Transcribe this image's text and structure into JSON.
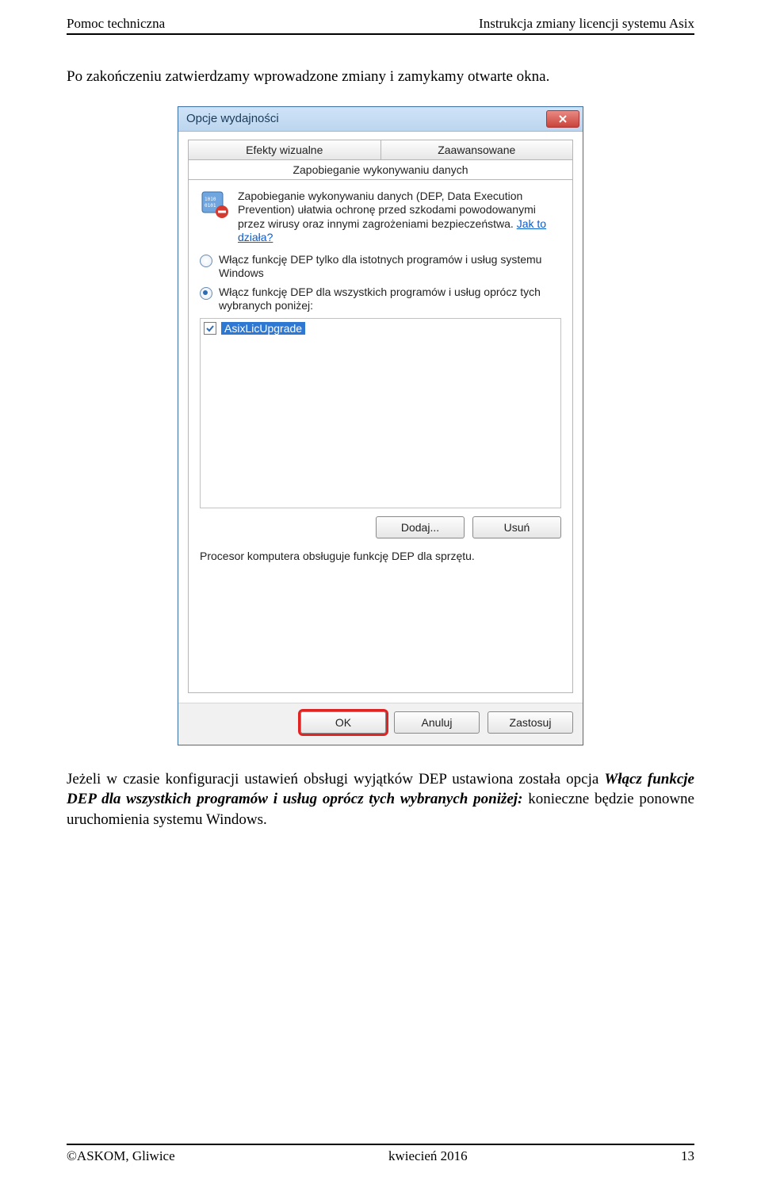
{
  "header": {
    "left": "Pomoc techniczna",
    "right": "Instrukcja zmiany licencji systemu Asix"
  },
  "intro": "Po zakończeniu zatwierdzamy wprowadzone zmiany i zamykamy otwarte okna.",
  "dialog": {
    "title": "Opcje wydajności",
    "tabs": {
      "visual": "Efekty wizualne",
      "advanced": "Zaawansowane",
      "dep": "Zapobieganie wykonywaniu danych"
    },
    "dep_description": "Zapobieganie wykonywaniu danych (DEP, Data Execution Prevention) ułatwia ochronę przed szkodami powodowanymi przez wirusy oraz innymi zagrożeniami bezpieczeństwa.",
    "dep_link": "Jak to działa?",
    "radio1": "Włącz funkcję DEP tylko dla istotnych programów i usług systemu Windows",
    "radio2": "Włącz funkcję DEP dla wszystkich programów i usług oprócz tych wybranych poniżej:",
    "list_item": "AsixLicUpgrade",
    "add_label": "Dodaj...",
    "remove_label": "Usuń",
    "note": "Procesor komputera obsługuje funkcję DEP dla sprzętu.",
    "ok_label": "OK",
    "cancel_label": "Anuluj",
    "apply_label": "Zastosuj"
  },
  "outro": {
    "p1a": "Jeżeli w czasie konfiguracji ustawień obsługi wyjątków DEP ustawiona została opcja ",
    "p1b": "Włącz funkcje DEP dla wszystkich programów i usług oprócz tych wybranych  poniżej:",
    "p1c": " konieczne będzie ponowne uruchomienia systemu Windows."
  },
  "footer": {
    "left": "©ASKOM, Gliwice",
    "center": "kwiecień 2016",
    "right": "13"
  }
}
